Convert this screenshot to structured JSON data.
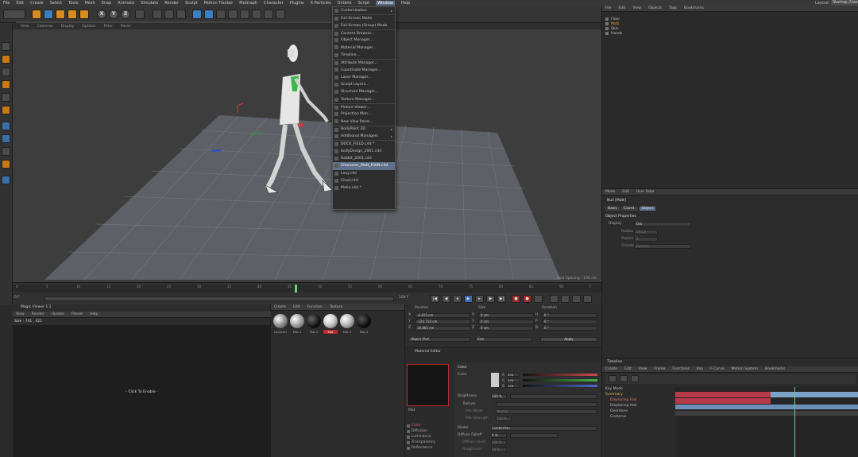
{
  "menubar": [
    "File",
    "Edit",
    "Create",
    "Select",
    "Tools",
    "Mesh",
    "Snap",
    "Animate",
    "Simulate",
    "Render",
    "Sculpt",
    "Motion Tracker",
    "MoGraph",
    "Character",
    "Plugins",
    "X-Particles",
    "Octane",
    "Script",
    "Window",
    "Help"
  ],
  "layout_label": "Layout:",
  "layout_value": "Startup (Use",
  "window_menu": [
    {
      "label": "Customization",
      "arrow": true
    },
    {
      "label": "Full-Screen Mode",
      "sep": true
    },
    {
      "label": "Full-Screen (Group) Mode"
    },
    {
      "label": "Content Browser...",
      "sep": true
    },
    {
      "label": "Object Manager..."
    },
    {
      "label": "Material Manager..."
    },
    {
      "label": "Timeline..."
    },
    {
      "label": "Attribute Manager...",
      "sep": true
    },
    {
      "label": "Coordinate Manager..."
    },
    {
      "label": "Layer Manager..."
    },
    {
      "label": "Sculpt Layers..."
    },
    {
      "label": "Structure Manager..."
    },
    {
      "label": "Texture Manager..."
    },
    {
      "label": "Picture Viewer...",
      "sep": true
    },
    {
      "label": "Projection Man..."
    },
    {
      "label": "New View Panel..."
    },
    {
      "label": "BodyPaint 3D",
      "arrow": true,
      "sep": true
    },
    {
      "label": "Additional Managers",
      "arrow": true
    },
    {
      "label": "DOCK_FIELD.c4d *",
      "sep": true
    },
    {
      "label": "bodyDesign_2001.c4d"
    },
    {
      "label": "Rabbit_2001.c4d"
    },
    {
      "label": "Character_Matt_FIXIN.c4d",
      "highlight": true
    },
    {
      "label": "Lexy.c4d"
    },
    {
      "label": "Chad.c4d"
    },
    {
      "label": "Melia.c4d *"
    }
  ],
  "object_manager": {
    "menu": [
      "File",
      "Edit",
      "View",
      "Objects",
      "Tags",
      "Bookmarks"
    ],
    "items": [
      "Floor",
      "Matt",
      "Skin",
      "Hands"
    ]
  },
  "attribute_manager": {
    "menu": [
      "Mode",
      "Edit",
      "User Data"
    ],
    "object": "Null [Matt]",
    "tabs": [
      "Basic",
      "Coord.",
      "Object"
    ],
    "section": "Object Properties",
    "display_label": "Display",
    "display_value": "Dot",
    "rows": [
      "Radius",
      "Aspect Ratio",
      "Orientation"
    ],
    "radius_value": "10 cm",
    "aspect_value": "1",
    "orientation_value": "Camera"
  },
  "timeline": {
    "title": "Timeline",
    "menu": [
      "Create",
      "Edit",
      "View",
      "Frame",
      "Functions",
      "Key",
      "F-Curve",
      "Motion System",
      "Bookmarks"
    ],
    "summary": "Summary",
    "tracks": [
      "Key Mode",
      "Summary",
      "Displacing Hair",
      "Displacing Hair",
      "Overdone",
      "Cerberus"
    ]
  },
  "viewport_menu": [
    "View",
    "Cameras",
    "Display",
    "Options",
    "Filter",
    "Panel"
  ],
  "viewport_hud": "Grid Spacing : 100 cm",
  "ruler_ticks": [
    "0",
    "5",
    "10",
    "15",
    "20",
    "25",
    "30",
    "35",
    "40",
    "45",
    "50",
    "55",
    "60",
    "65",
    "70",
    "75",
    "80",
    "85",
    "90",
    "F"
  ],
  "frame_start": "0 F",
  "frame_end": "100 F",
  "magic_viewer": {
    "title": "Magic Viewer 1.1",
    "menu": [
      "View",
      "Render",
      "Update",
      "Preset",
      "Help"
    ],
    "size": "Size : 741 , 421",
    "hint": "- Click To Enable -"
  },
  "material_manager": {
    "menu": [
      "Create",
      "Edit",
      "Function",
      "Texture"
    ],
    "names": [
      "Lambert",
      "Mat.1",
      "Mat.2",
      "Mat",
      "Mat.3",
      "Mat.4"
    ]
  },
  "coordinates": {
    "headers": [
      "Position",
      "Size",
      "Rotation"
    ],
    "rows": [
      {
        "axis": "X",
        "pos": "-2.415 cm",
        "size": "0 cm",
        "rot_label": "H",
        "rot": "0 °"
      },
      {
        "axis": "Y",
        "pos": "-124.714 cm",
        "size": "0 cm",
        "rot_label": "P",
        "rot": "0 °"
      },
      {
        "axis": "Z",
        "pos": "10.865 cm",
        "size": "0 cm",
        "rot_label": "B",
        "rot": "0 °"
      }
    ],
    "mode": "Object (Rel)",
    "size_mode": "Size",
    "apply": "Apply"
  },
  "material_editor": {
    "title": "Material Editor",
    "mat_name": "Mat",
    "channels": [
      "Color",
      "Diffusion",
      "Luminance",
      "Transparency",
      "Reflectance"
    ],
    "section": "Color",
    "color_label": "Color",
    "rgb": [
      {
        "c": "R",
        "v": "204"
      },
      {
        "c": "G",
        "v": "204"
      },
      {
        "c": "B",
        "v": "204"
      }
    ],
    "brightness_label": "Brightness",
    "brightness": "100 %",
    "texture_label": "Texture",
    "mix_mode_label": "Mix Mode",
    "mix_mode": "Normal",
    "mix_strength_label": "Mix Strength",
    "mix_strength": "100 %",
    "model_label": "Model",
    "model": "Lambertian",
    "falloff_label": "Diffuse Falloff",
    "falloff": "0 %",
    "level_label": "Diffuse Level",
    "level": "100 %",
    "roughness_label": "Roughness",
    "roughness": "50 %"
  }
}
